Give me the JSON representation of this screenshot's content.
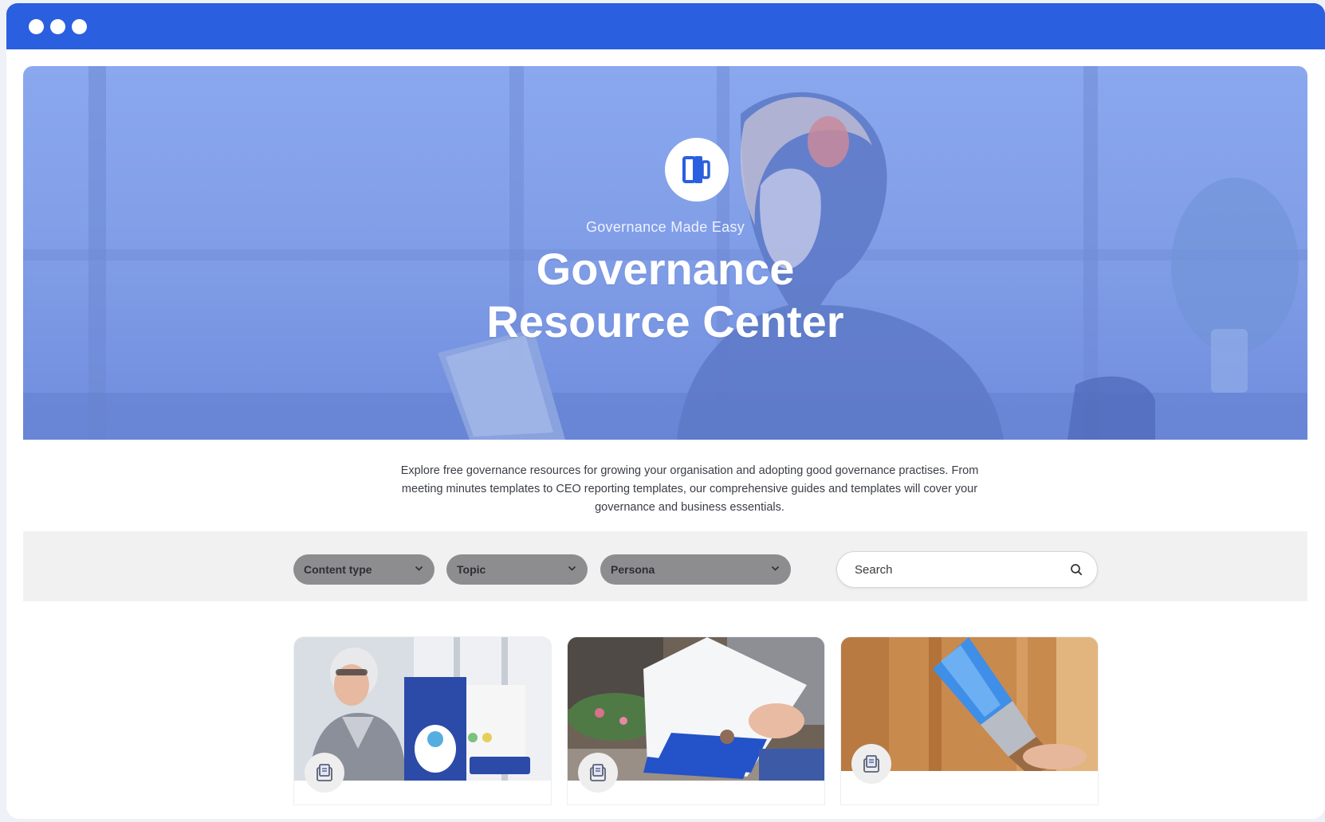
{
  "window": {
    "titlebar_color": "#2a5fdf"
  },
  "hero": {
    "logo_icon": "boardpro-logo-icon",
    "eyebrow": "Governance Made Easy",
    "title_line1": "Governance",
    "title_line2": "Resource Center"
  },
  "intro": {
    "text": "Explore free governance resources for growing your organisation and adopting good governance practises. From meeting minutes templates to CEO reporting templates, our comprehensive guides and templates will cover your governance and business essentials."
  },
  "filters": {
    "content_type": {
      "label": "Content type"
    },
    "topic": {
      "label": "Topic"
    },
    "persona": {
      "label": "Persona"
    },
    "search": {
      "placeholder": "Search"
    }
  },
  "cards": [
    {
      "badge_icon": "document-stack-icon",
      "image": "woman-with-playbook-brochure"
    },
    {
      "badge_icon": "document-stack-icon",
      "image": "person-reading-booklet"
    },
    {
      "badge_icon": "document-stack-icon",
      "image": "paintbrush-on-wood"
    }
  ],
  "colors": {
    "brand_blue": "#2a5fdf",
    "hero_overlay": "#7f9ce6",
    "select_bg": "#8d8d8f",
    "filter_bar_bg": "#f1f1f2"
  }
}
